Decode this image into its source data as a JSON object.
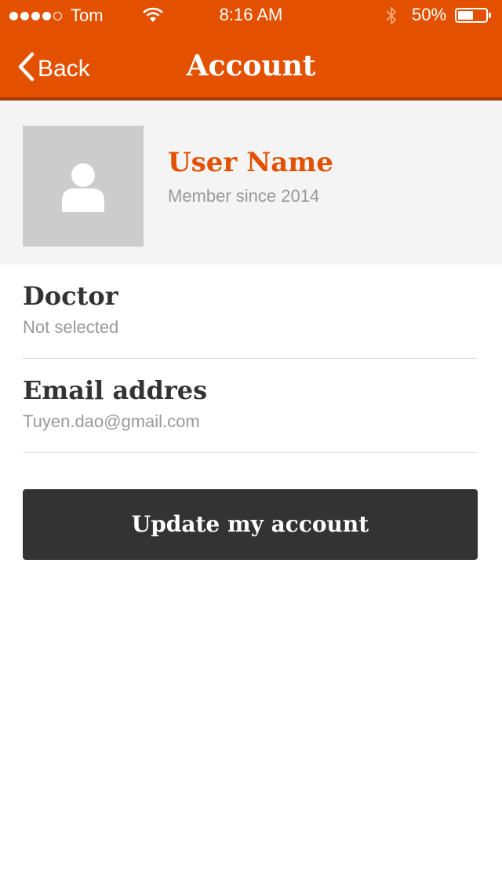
{
  "status_bar": {
    "carrier": "Tom",
    "signal_bars_filled": 4,
    "signal_bars_total": 5,
    "time": "8:16 AM",
    "battery_percent": "50%",
    "battery_level": 0.5,
    "icons": [
      "wifi-icon",
      "bluetooth-icon",
      "battery-icon"
    ]
  },
  "nav": {
    "back_label": "Back",
    "title": "Account"
  },
  "profile": {
    "avatar_icon": "user-silhouette-icon",
    "name": "User Name",
    "member_since": "Member since 2014"
  },
  "fields": {
    "doctor": {
      "label": "Doctor",
      "value": "Not selected"
    },
    "email": {
      "label": "Email addres",
      "value": "Tuyen.dao@gmail.com"
    }
  },
  "actions": {
    "update_label": "Update my account"
  },
  "colors": {
    "accent": "#e35100",
    "nav_border": "#a63800",
    "button_bg": "#333333",
    "profile_bg": "#f4f4f4",
    "avatar_bg": "#cccccc",
    "muted_text": "#999999"
  }
}
